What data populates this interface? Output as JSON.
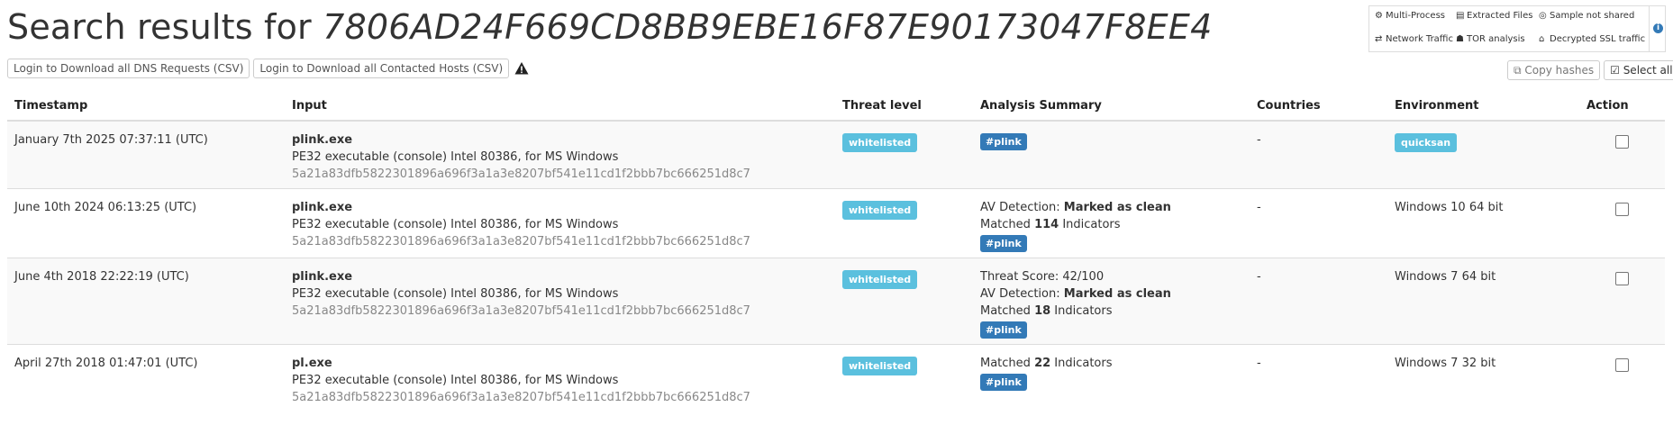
{
  "header": {
    "title_prefix": "Search results for ",
    "query_hash": "7806AD24F669CD8BB9EBE16F87E90173047F8EE4"
  },
  "buttons": {
    "dns_csv": "Login to Download all DNS Requests (CSV)",
    "hosts_csv": "Login to Download all Contacted Hosts (CSV)",
    "copy_hashes": "Copy hashes",
    "select_all": "Select all"
  },
  "legend": {
    "multi_process": "Multi-Process",
    "extracted_files": "Extracted Files",
    "sample_not_shared": "Sample not shared",
    "network_traffic": "Network Traffic",
    "tor_analysis": "TOR analysis",
    "decrypted_ssl": "Decrypted SSL traffic"
  },
  "columns": {
    "timestamp": "Timestamp",
    "input": "Input",
    "threat_level": "Threat level",
    "analysis_summary": "Analysis Summary",
    "countries": "Countries",
    "environment": "Environment",
    "action": "Action"
  },
  "rows": [
    {
      "timestamp": "January 7th 2025 07:37:11 (UTC)",
      "filename": "plink.exe",
      "filetype": "PE32 executable (console) Intel 80386, for MS Windows",
      "sha256": "5a21a83dfb5822301896a696f3a1a3e8207bf541e11cd1f2bbb7bc666251d8c7",
      "threat": "whitelisted",
      "tag": "#plink",
      "countries": "-",
      "environment": "quicksan"
    },
    {
      "timestamp": "June 10th 2024 06:13:25 (UTC)",
      "filename": "plink.exe",
      "filetype": "PE32 executable (console) Intel 80386, for MS Windows",
      "sha256": "5a21a83dfb5822301896a696f3a1a3e8207bf541e11cd1f2bbb7bc666251d8c7",
      "threat": "whitelisted",
      "av_label": "AV Detection: ",
      "av_value": "Marked as clean",
      "matched_prefix": "Matched ",
      "matched_count": "114",
      "matched_suffix": " Indicators",
      "tag": "#plink",
      "countries": "-",
      "environment": "Windows 10 64 bit"
    },
    {
      "timestamp": "June 4th 2018 22:22:19 (UTC)",
      "filename": "plink.exe",
      "filetype": "PE32 executable (console) Intel 80386, for MS Windows",
      "sha256": "5a21a83dfb5822301896a696f3a1a3e8207bf541e11cd1f2bbb7bc666251d8c7",
      "threat": "whitelisted",
      "threat_score": "Threat Score: 42/100",
      "av_label": "AV Detection: ",
      "av_value": "Marked as clean",
      "matched_prefix": "Matched ",
      "matched_count": "18",
      "matched_suffix": " Indicators",
      "tag": "#plink",
      "countries": "-",
      "environment": "Windows 7 64 bit"
    },
    {
      "timestamp": "April 27th 2018 01:47:01 (UTC)",
      "filename": "pl.exe",
      "filetype": "PE32 executable (console) Intel 80386, for MS Windows",
      "sha256": "5a21a83dfb5822301896a696f3a1a3e8207bf541e11cd1f2bbb7bc666251d8c7",
      "threat": "whitelisted",
      "matched_prefix": "Matched ",
      "matched_count": "22",
      "matched_suffix": " Indicators",
      "tag": "#plink",
      "countries": "-",
      "environment": "Windows 7 32 bit"
    }
  ],
  "colors": {
    "label_info": "#5bc0de",
    "tag_primary": "#337ab7"
  }
}
